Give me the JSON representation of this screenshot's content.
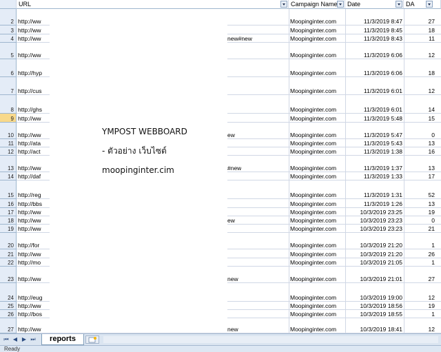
{
  "columns": {
    "url": "URL",
    "campaign": "Campaign Name",
    "date": "Date",
    "da": "DA"
  },
  "rows": [
    {
      "n": "2",
      "url": "http://ww",
      "extra": "",
      "campaign": "Moopinginter.com",
      "date": "11/3/2019 8:47",
      "da": "27"
    },
    {
      "n": "3",
      "url": "http://ww",
      "extra": "",
      "campaign": "Moopinginter.com",
      "date": "11/3/2019 8:45",
      "da": "18"
    },
    {
      "n": "4",
      "url": "http://ww",
      "extra": "new#new",
      "campaign": "Moopinginter.com",
      "date": "11/3/2019 8:43",
      "da": "11"
    },
    {
      "n": "5",
      "url": "http://ww",
      "extra": "",
      "campaign": "Moopinginter.com",
      "date": "11/3/2019 6:06",
      "da": "12"
    },
    {
      "n": "6",
      "url": "http://hyp",
      "extra": "",
      "campaign": "Moopinginter.com",
      "date": "11/3/2019 6:06",
      "da": "18"
    },
    {
      "n": "7",
      "url": "http://cus",
      "extra": "",
      "campaign": "Moopinginter.com",
      "date": "11/3/2019 6:01",
      "da": "12"
    },
    {
      "n": "8",
      "url": "http://ghs",
      "extra": "",
      "campaign": "Moopinginter.com",
      "date": "11/3/2019 6:01",
      "da": "14"
    },
    {
      "n": "9",
      "url": "http://ww",
      "extra": "",
      "campaign": "Moopinginter.com",
      "date": "11/3/2019 5:48",
      "da": "15"
    },
    {
      "n": "10",
      "url": "http://ww",
      "extra": "ew",
      "campaign": "Moopinginter.com",
      "date": "11/3/2019 5:47",
      "da": "0"
    },
    {
      "n": "11",
      "url": "http://ata",
      "extra": "",
      "campaign": "Moopinginter.com",
      "date": "11/3/2019 5:43",
      "da": "13"
    },
    {
      "n": "12",
      "url": "http://act",
      "extra": "",
      "campaign": "Moopinginter.com",
      "date": "11/3/2019 1:38",
      "da": "16"
    },
    {
      "n": "13",
      "url": "http://ww",
      "extra": "#new",
      "campaign": "Moopinginter.com",
      "date": "11/3/2019 1:37",
      "da": "13"
    },
    {
      "n": "14",
      "url": "http://daf",
      "extra": "",
      "campaign": "Moopinginter.com",
      "date": "11/3/2019 1:33",
      "da": "17"
    },
    {
      "n": "15",
      "url": "http://reg",
      "extra": "",
      "campaign": "Moopinginter.com",
      "date": "11/3/2019 1:31",
      "da": "52"
    },
    {
      "n": "16",
      "url": "http://bbs",
      "extra": "",
      "campaign": "Moopinginter.com",
      "date": "11/3/2019 1:26",
      "da": "13"
    },
    {
      "n": "17",
      "url": "http://ww",
      "extra": "",
      "campaign": "Moopinginter.com",
      "date": "10/3/2019 23:25",
      "da": "19"
    },
    {
      "n": "18",
      "url": "http://ww",
      "extra": "ew",
      "campaign": "Moopinginter.com",
      "date": "10/3/2019 23:23",
      "da": "0"
    },
    {
      "n": "19",
      "url": "http://ww",
      "extra": "",
      "campaign": "Moopinginter.com",
      "date": "10/3/2019 23:23",
      "da": "21"
    },
    {
      "n": "20",
      "url": "http://for",
      "extra": "",
      "campaign": "Moopinginter.com",
      "date": "10/3/2019 21:20",
      "da": "1"
    },
    {
      "n": "21",
      "url": "http://ww",
      "extra": "",
      "campaign": "Moopinginter.com",
      "date": "10/3/2019 21:20",
      "da": "26"
    },
    {
      "n": "22",
      "url": "http://mo",
      "extra": "",
      "campaign": "Moopinginter.com",
      "date": "10/3/2019 21:05",
      "da": "1"
    },
    {
      "n": "23",
      "url": "http://ww",
      "extra": "new",
      "campaign": "Moopinginter.com",
      "date": "10/3/2019 21:01",
      "da": "27"
    },
    {
      "n": "24",
      "url": "http://eug",
      "extra": "",
      "campaign": "Moopinginter.com",
      "date": "10/3/2019 19:00",
      "da": "12"
    },
    {
      "n": "25",
      "url": "http://ww",
      "extra": "",
      "campaign": "Moopinginter.com",
      "date": "10/3/2019 18:56",
      "da": "19"
    },
    {
      "n": "26",
      "url": "http://bos",
      "extra": "",
      "campaign": "Moopinginter.com",
      "date": "10/3/2019 18:55",
      "da": "1"
    },
    {
      "n": "27",
      "url": "http://ww",
      "extra": "new",
      "campaign": "Moopinginter.com",
      "date": "10/3/2019 18:41",
      "da": "12"
    }
  ],
  "overlay": {
    "title": "YMPOST WEBBOARD",
    "line2": "- ตัวอย่าง  เว็บไซต์",
    "line3": "moopinginter.cim"
  },
  "sheet_tab": "reports",
  "status": "Ready"
}
